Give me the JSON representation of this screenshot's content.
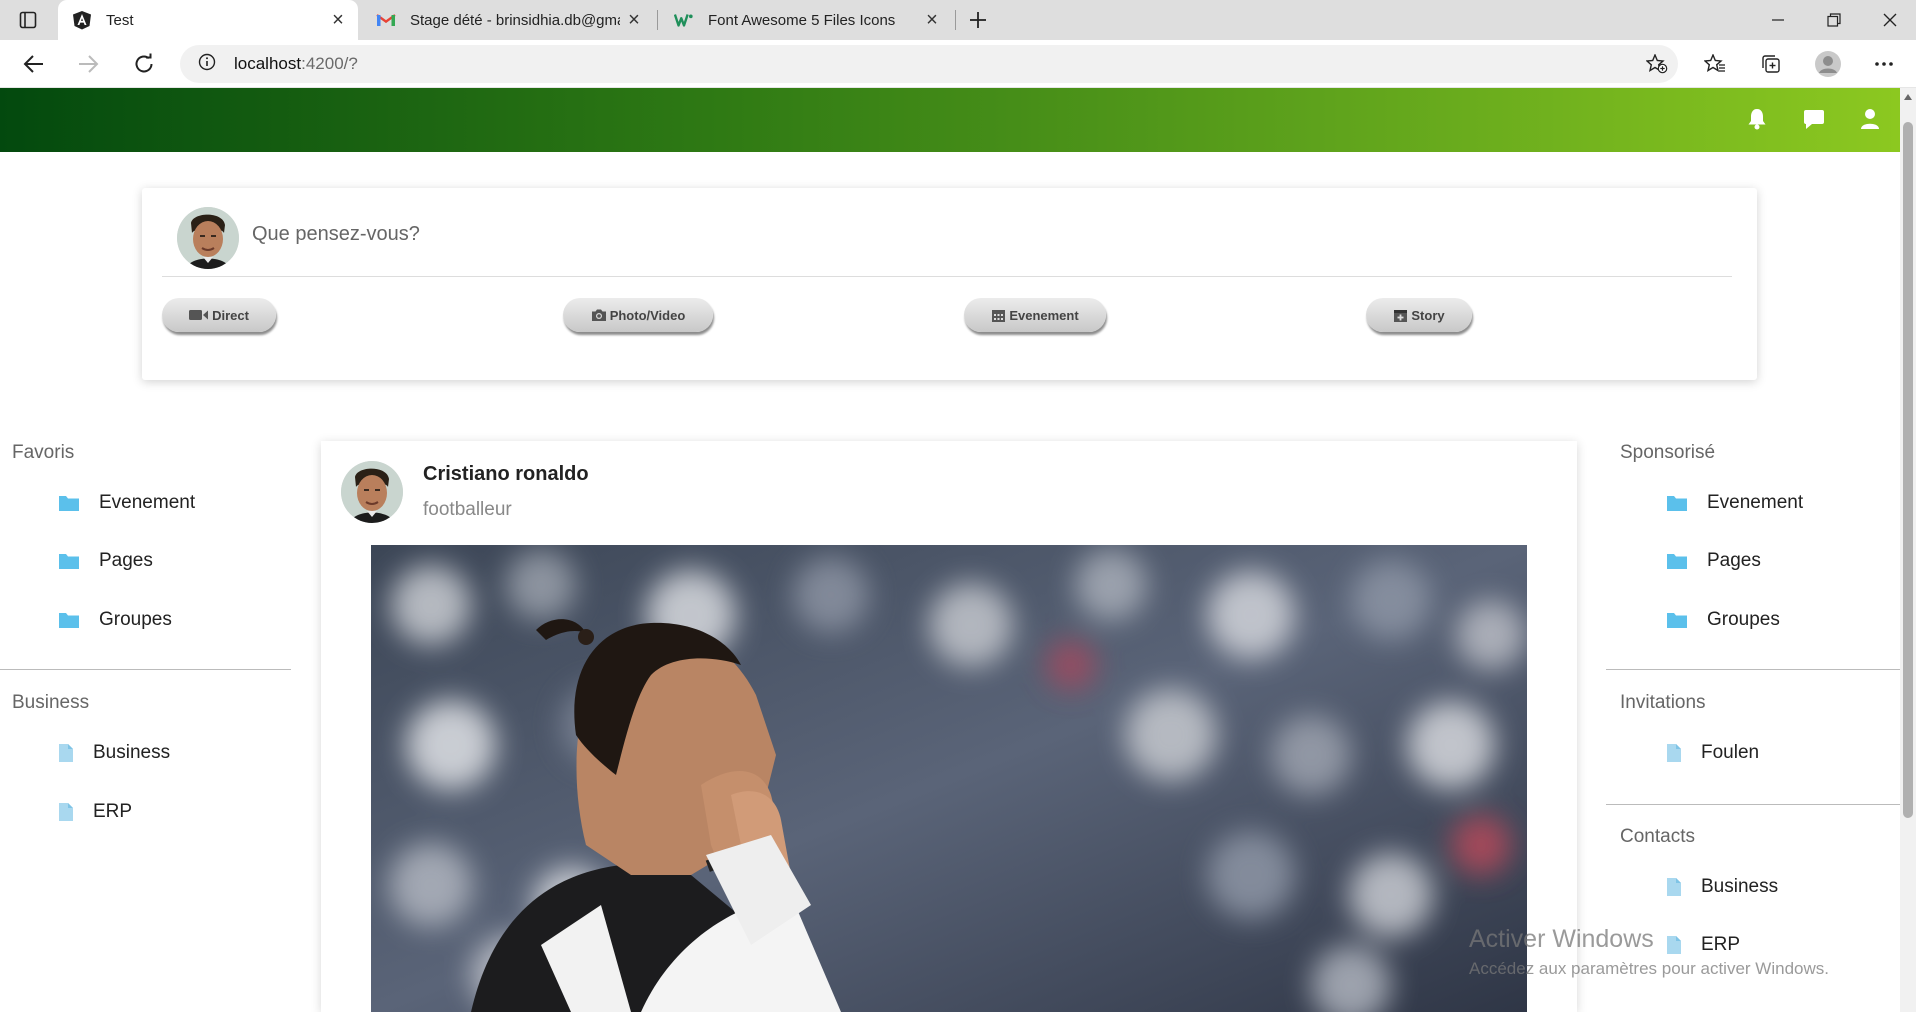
{
  "browser": {
    "tabs": [
      {
        "title": "Test",
        "icon": "angular-icon"
      },
      {
        "title": "Stage dété - brinsidhia.db@gma",
        "icon": "gmail-icon"
      },
      {
        "title": "Font Awesome 5 Files Icons",
        "icon": "w-icon"
      }
    ],
    "url_host": "localhost",
    "url_path": ":4200/?"
  },
  "colors": {
    "header_gradient_start": "#03490e",
    "header_gradient_end": "#8cc820",
    "folder_icon": "#5bc0eb",
    "file_icon": "#a9d8ef"
  },
  "composer": {
    "placeholder": "Que pensez-vous?",
    "actions": [
      {
        "label": "Direct",
        "icon": "video-icon"
      },
      {
        "label": "Photo/Video",
        "icon": "camera-icon"
      },
      {
        "label": "Evenement",
        "icon": "calendar-icon"
      },
      {
        "label": "Story",
        "icon": "calendar-plus-icon"
      }
    ]
  },
  "left_sidebar": {
    "favoris": {
      "heading": "Favoris",
      "items": [
        "Evenement",
        "Pages",
        "Groupes"
      ]
    },
    "business": {
      "heading": "Business",
      "items": [
        "Business",
        "ERP"
      ]
    }
  },
  "right_sidebar": {
    "sponsorise": {
      "heading": "Sponsorisé",
      "items": [
        "Evenement",
        "Pages",
        "Groupes"
      ]
    },
    "invitations": {
      "heading": "Invitations",
      "items": [
        "Foulen"
      ]
    },
    "contacts": {
      "heading": "Contacts",
      "items": [
        "Business",
        "ERP"
      ]
    }
  },
  "post": {
    "author": "Cristiano ronaldo",
    "role": "footballeur"
  },
  "watermark": {
    "title": "Activer Windows",
    "subtitle": "Accédez aux paramètres pour activer Windows."
  }
}
